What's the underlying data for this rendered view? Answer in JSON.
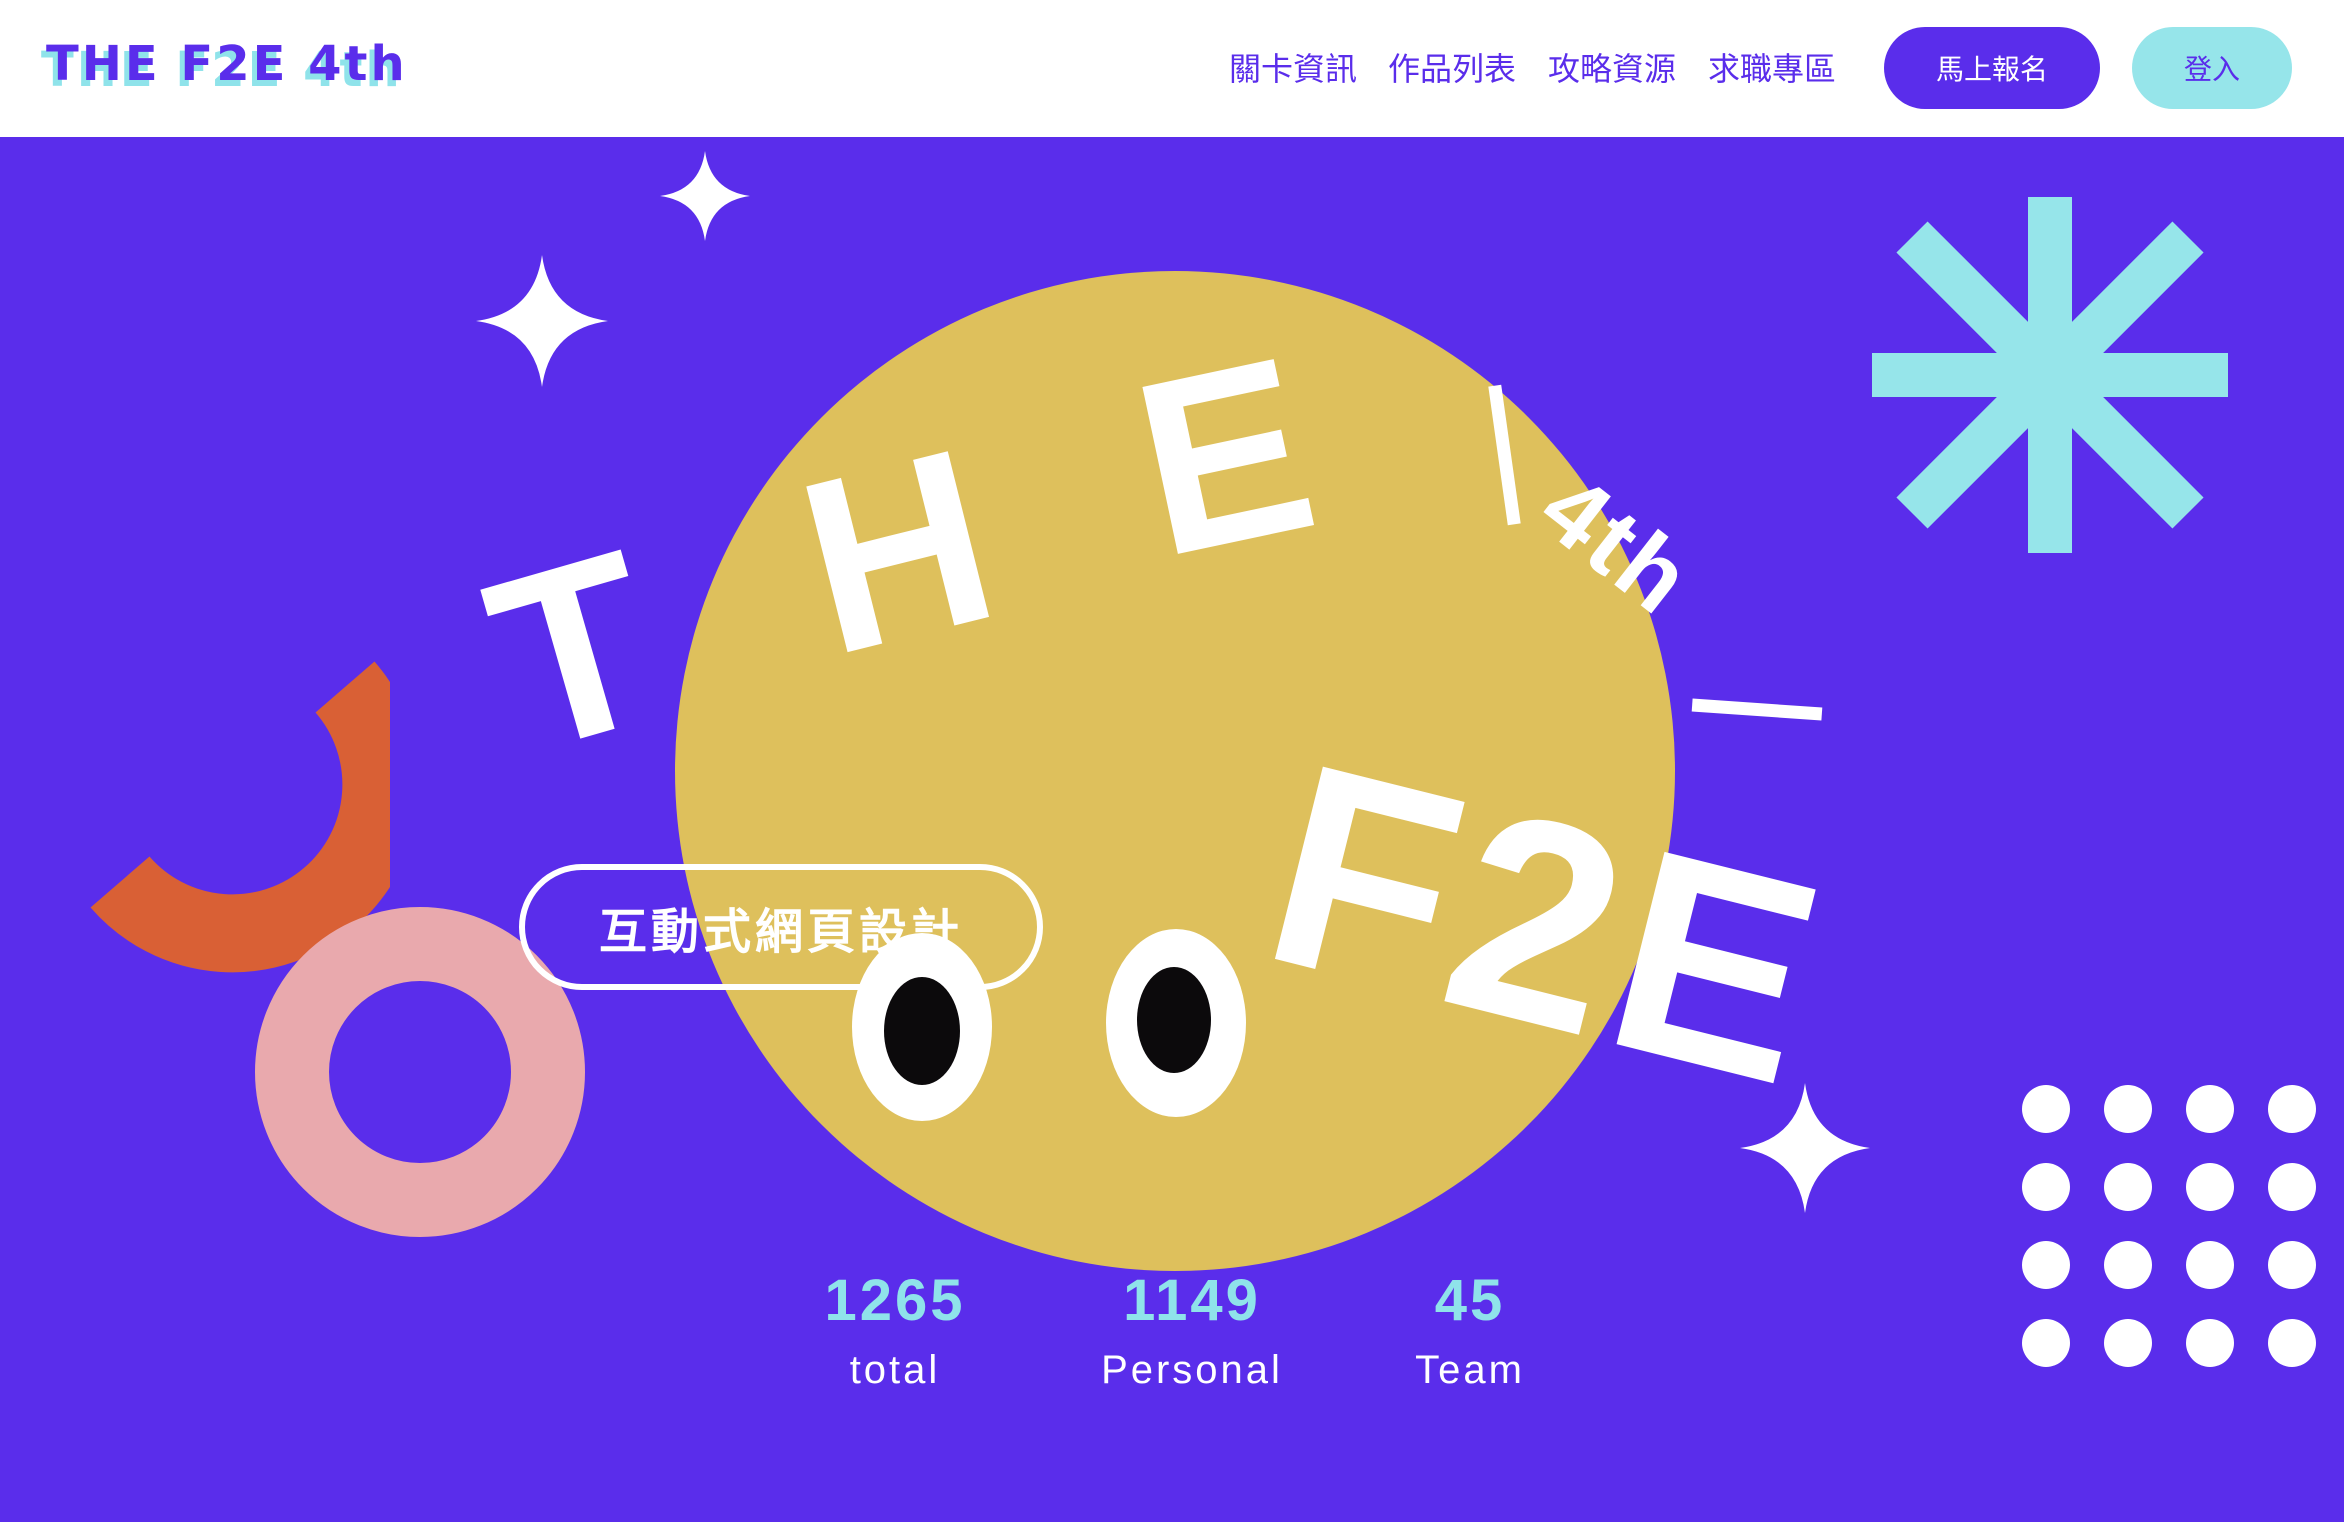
{
  "header": {
    "logo": "THE F2E 4th",
    "nav": [
      "關卡資訊",
      "作品列表",
      "攻略資源",
      "求職專區"
    ],
    "signup_label": "馬上報名",
    "login_label": "登入"
  },
  "hero": {
    "title_the": "THE",
    "title_f2e": "F2E",
    "title_edition": "4th",
    "pill_label": "互動式網頁設計"
  },
  "stats": [
    {
      "value": "1265",
      "label": "total"
    },
    {
      "value": "1149",
      "label": "Personal"
    },
    {
      "value": "45",
      "label": "Team"
    }
  ],
  "colors": {
    "brand_purple": "#5a2deb",
    "cyan": "#96e5ea",
    "mustard": "#dec05c",
    "orange": "#d96035",
    "pink": "#e9a9ad",
    "white": "#ffffff"
  },
  "icons": [
    "sparkle-icon",
    "asterisk-icon",
    "dot-grid-icon",
    "eyes-icon"
  ]
}
